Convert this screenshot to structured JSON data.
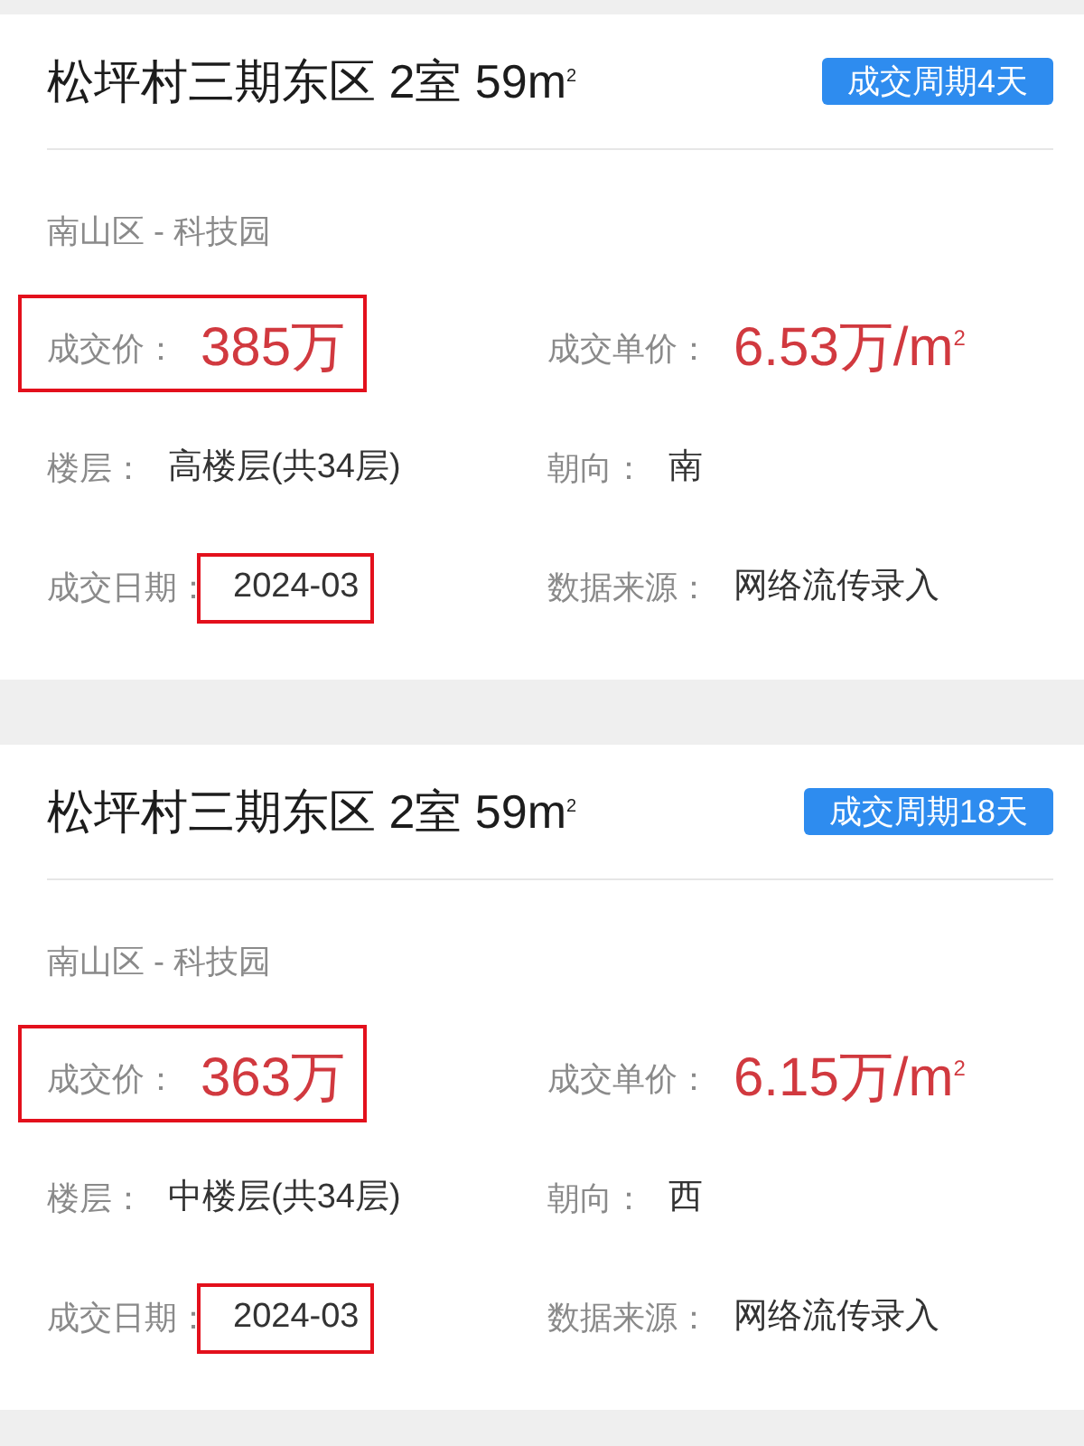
{
  "listings": [
    {
      "title": "松坪村三期东区 2室 59m$^{2}$",
      "badge": "成交周期4天",
      "location": "南山区 - 科技园",
      "fields": [
        {
          "label": "成交价：",
          "value": "385万",
          "kind": "price",
          "framed": true,
          "value_framed": false
        },
        {
          "label": "成交单价：",
          "value": "6.53万/m$^{2}$",
          "kind": "price",
          "framed": false,
          "value_framed": false
        },
        {
          "label": "楼层：",
          "value": "高楼层(共34层)",
          "kind": "info",
          "framed": false,
          "value_framed": false
        },
        {
          "label": "朝向：",
          "value": "南",
          "kind": "info",
          "framed": false,
          "value_framed": false
        },
        {
          "label": "成交日期：",
          "value": "2024-03",
          "kind": "info",
          "framed": false,
          "value_framed": true
        },
        {
          "label": "数据来源：",
          "value": "网络流传录入",
          "kind": "info",
          "framed": false,
          "value_framed": false
        }
      ]
    },
    {
      "title": "松坪村三期东区 2室 59m$^{2}$",
      "badge": "成交周期18天",
      "location": "南山区 - 科技园",
      "fields": [
        {
          "label": "成交价：",
          "value": "363万",
          "kind": "price",
          "framed": true,
          "value_framed": false
        },
        {
          "label": "成交单价：",
          "value": "6.15万/m$^{2}$",
          "kind": "price",
          "framed": false,
          "value_framed": false
        },
        {
          "label": "楼层：",
          "value": "中楼层(共34层)",
          "kind": "info",
          "framed": false,
          "value_framed": false
        },
        {
          "label": "朝向：",
          "value": "西",
          "kind": "info",
          "framed": false,
          "value_framed": false
        },
        {
          "label": "成交日期：",
          "value": "2024-03",
          "kind": "info",
          "framed": false,
          "value_framed": true
        },
        {
          "label": "数据来源：",
          "value": "网络流传录入",
          "kind": "info",
          "framed": false,
          "value_framed": false
        }
      ]
    }
  ]
}
